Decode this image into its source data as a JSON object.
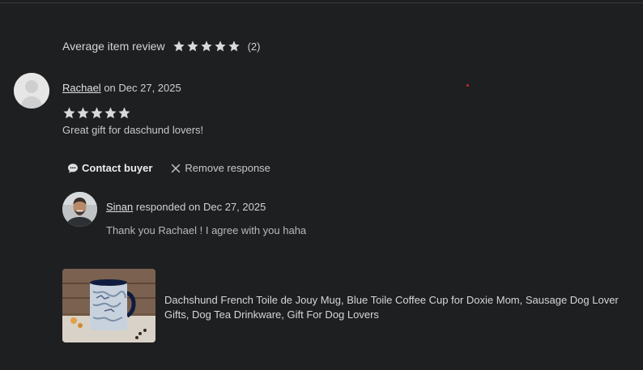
{
  "summary": {
    "label": "Average item review",
    "rating": 5,
    "count": "(2)"
  },
  "review": {
    "reviewer": "Rachael",
    "date_text": " on Dec 27, 2025",
    "rating": 5,
    "text": "Great gift for daschund lovers!"
  },
  "actions": {
    "contact": "Contact buyer",
    "remove": "Remove response"
  },
  "response": {
    "responder": "Sinan",
    "meta_text": " responded on Dec 27, 2025",
    "text": "Thank you Rachael ! I agree with you haha"
  },
  "product": {
    "title": "Dachshund French Toile de Jouy Mug, Blue Toile Coffee Cup for Doxie Mom, Sausage Dog Lover Gifts, Dog Tea Drinkware, Gift For Dog Lovers"
  },
  "icons": {
    "star": "star-icon",
    "contact": "chat-bubble-icon",
    "remove": "close-icon"
  },
  "colors": {
    "background": "#1e1f21",
    "text": "#d0d0d0",
    "star": "#d9d9d9",
    "dot": "#d1262b"
  }
}
